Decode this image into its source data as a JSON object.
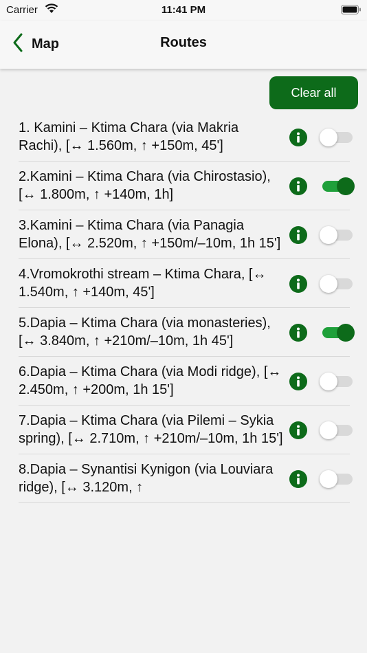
{
  "status_bar": {
    "carrier": "Carrier",
    "time": "11:41 PM"
  },
  "nav": {
    "back_label": "Map",
    "title": "Routes"
  },
  "actions": {
    "clear_all_label": "Clear all"
  },
  "colors": {
    "accent": "#0d6b1a",
    "toggle_on_track": "#1fa03a",
    "toggle_off_track": "#d9d9d9"
  },
  "routes": [
    {
      "text": "1. Kamini – Ktima Chara (via Makria Rachi),  [↔ 1.560m, ↑ +150m, 45']",
      "enabled": false
    },
    {
      "text": "2.Kamini – Ktima Chara (via Chirostasio), [↔ 1.800m, ↑ +140m, 1h]",
      "enabled": true
    },
    {
      "text": "3.Kamini – Ktima Chara (via Panagia Elona), [↔ 2.520m, ↑ +150m/–10m, 1h 15']",
      "enabled": false
    },
    {
      "text": "4.Vromokrothi stream – Ktima Chara, [↔ 1.540m, ↑ +140m, 45']",
      "enabled": false
    },
    {
      "text": "5.Dapia – Ktima Chara (via monasteries), [↔ 3.840m, ↑ +210m/–10m, 1h 45']",
      "enabled": true
    },
    {
      "text": "6.Dapia – Ktima Chara (via Modi ridge), [↔ 2.450m, ↑ +200m, 1h 15']",
      "enabled": false
    },
    {
      "text": "7.Dapia – Ktima Chara (via Pilemi – Sykia spring), [↔ 2.710m, ↑ +210m/–10m, 1h 15']",
      "enabled": false
    },
    {
      "text": "8.Dapia – Synantisi Kynigon (via Louviara ridge), [↔ 3.120m, ↑",
      "enabled": false
    }
  ]
}
